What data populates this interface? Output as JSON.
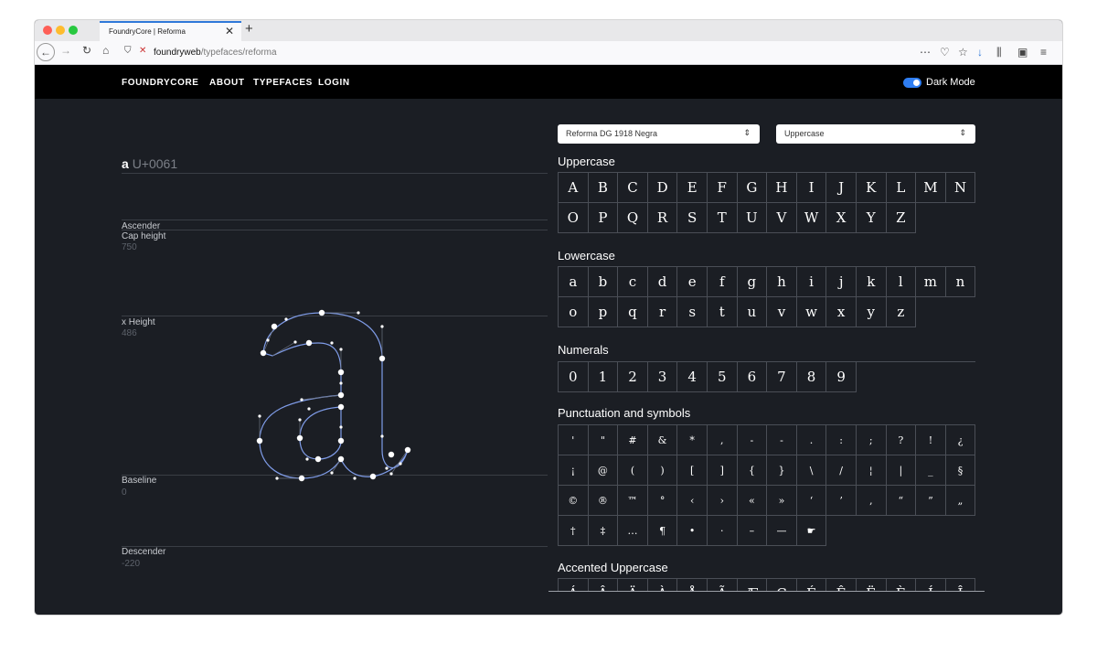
{
  "browser": {
    "tab_title": "FoundryCore | Reforma",
    "url_host": "foundryweb",
    "url_path": "/typefaces/reforma"
  },
  "nav": {
    "brand": "FOUNDRYCORE",
    "about": "ABOUT",
    "typefaces": "TYPEFACES",
    "login": "LOGIN",
    "dark_mode": "Dark Mode"
  },
  "glyph": {
    "char": "a",
    "code": "U+0061"
  },
  "metrics": {
    "ascender": "Ascender",
    "cap_height": "Cap height",
    "cap_height_value": "750",
    "x_height": "x Height",
    "x_height_value": "486",
    "baseline": "Baseline",
    "baseline_value": "0",
    "descender": "Descender",
    "descender_value": "-220"
  },
  "controls": {
    "font_select": "Reforma DG 1918 Negra",
    "set_select": "Uppercase"
  },
  "sections": {
    "uppercase": "Uppercase",
    "lowercase": "Lowercase",
    "numerals": "Numerals",
    "punct": "Punctuation and symbols",
    "accented": "Accented Uppercase"
  },
  "glyphs_uppercase": [
    "A",
    "B",
    "C",
    "D",
    "E",
    "F",
    "G",
    "H",
    "I",
    "J",
    "K",
    "L",
    "M",
    "N",
    "O",
    "P",
    "Q",
    "R",
    "S",
    "T",
    "U",
    "V",
    "W",
    "X",
    "Y",
    "Z"
  ],
  "glyphs_lowercase": [
    "a",
    "b",
    "c",
    "d",
    "e",
    "f",
    "g",
    "h",
    "i",
    "j",
    "k",
    "l",
    "m",
    "n",
    "o",
    "p",
    "q",
    "r",
    "s",
    "t",
    "u",
    "v",
    "w",
    "x",
    "y",
    "z"
  ],
  "glyphs_numerals": [
    "0",
    "1",
    "2",
    "3",
    "4",
    "5",
    "6",
    "7",
    "8",
    "9"
  ],
  "glyphs_punct": [
    "'",
    "\"",
    "#",
    "&",
    "*",
    ",",
    "-",
    "-",
    ".",
    ":",
    ";",
    "?",
    "!",
    "¿",
    "¡",
    "@",
    "(",
    ")",
    "[",
    "]",
    "{",
    "}",
    "\\",
    "/",
    "¦",
    "|",
    "_",
    "§",
    "©",
    "®",
    "™",
    "°",
    "‹",
    "›",
    "«",
    "»",
    "‘",
    "’",
    "‚",
    "“",
    "”",
    "„",
    "†",
    "‡",
    "…",
    "¶",
    "•",
    "·",
    "–",
    "—",
    "☛"
  ],
  "glyphs_accented": [
    "Á",
    "Â",
    "Ä",
    "À",
    "Å",
    "Ã",
    "Æ",
    "Ç",
    "É",
    "Ê",
    "Ë",
    "È",
    "Í",
    "Î"
  ]
}
